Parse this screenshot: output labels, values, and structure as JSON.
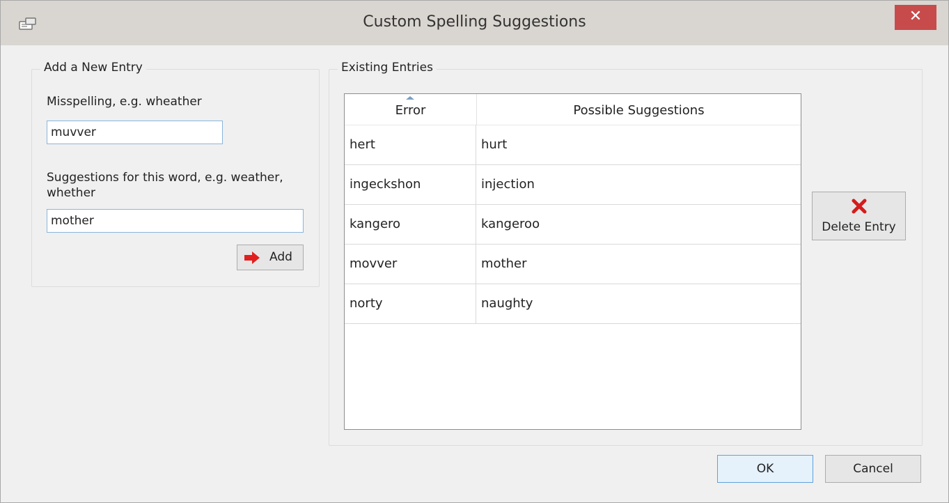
{
  "window": {
    "title": "Custom Spelling Suggestions",
    "close_label": "✕",
    "icon": "app-icon"
  },
  "add_group": {
    "legend": "Add a New Entry",
    "misspelling_label": "Misspelling, e.g. wheather",
    "misspelling_value": "muvver",
    "suggestions_label": "Suggestions for this word, e.g. weather, whether",
    "suggestions_value": "mother",
    "add_label": "Add",
    "add_icon": "arrow-right-icon",
    "add_icon_color": "#e02020"
  },
  "existing_group": {
    "legend": "Existing Entries",
    "columns": [
      "Error",
      "Possible Suggestions"
    ],
    "sorted_column": "Error",
    "rows": [
      {
        "error": "hert",
        "suggestion": "hurt"
      },
      {
        "error": "ingeckshon",
        "suggestion": "injection"
      },
      {
        "error": "kangero",
        "suggestion": "kangeroo"
      },
      {
        "error": "movver",
        "suggestion": "mother"
      },
      {
        "error": "norty",
        "suggestion": "naughty"
      }
    ],
    "delete_label": "Delete Entry",
    "delete_icon": "red-x-icon",
    "delete_icon_color": "#d41c1c"
  },
  "footer": {
    "ok_label": "OK",
    "cancel_label": "Cancel"
  }
}
